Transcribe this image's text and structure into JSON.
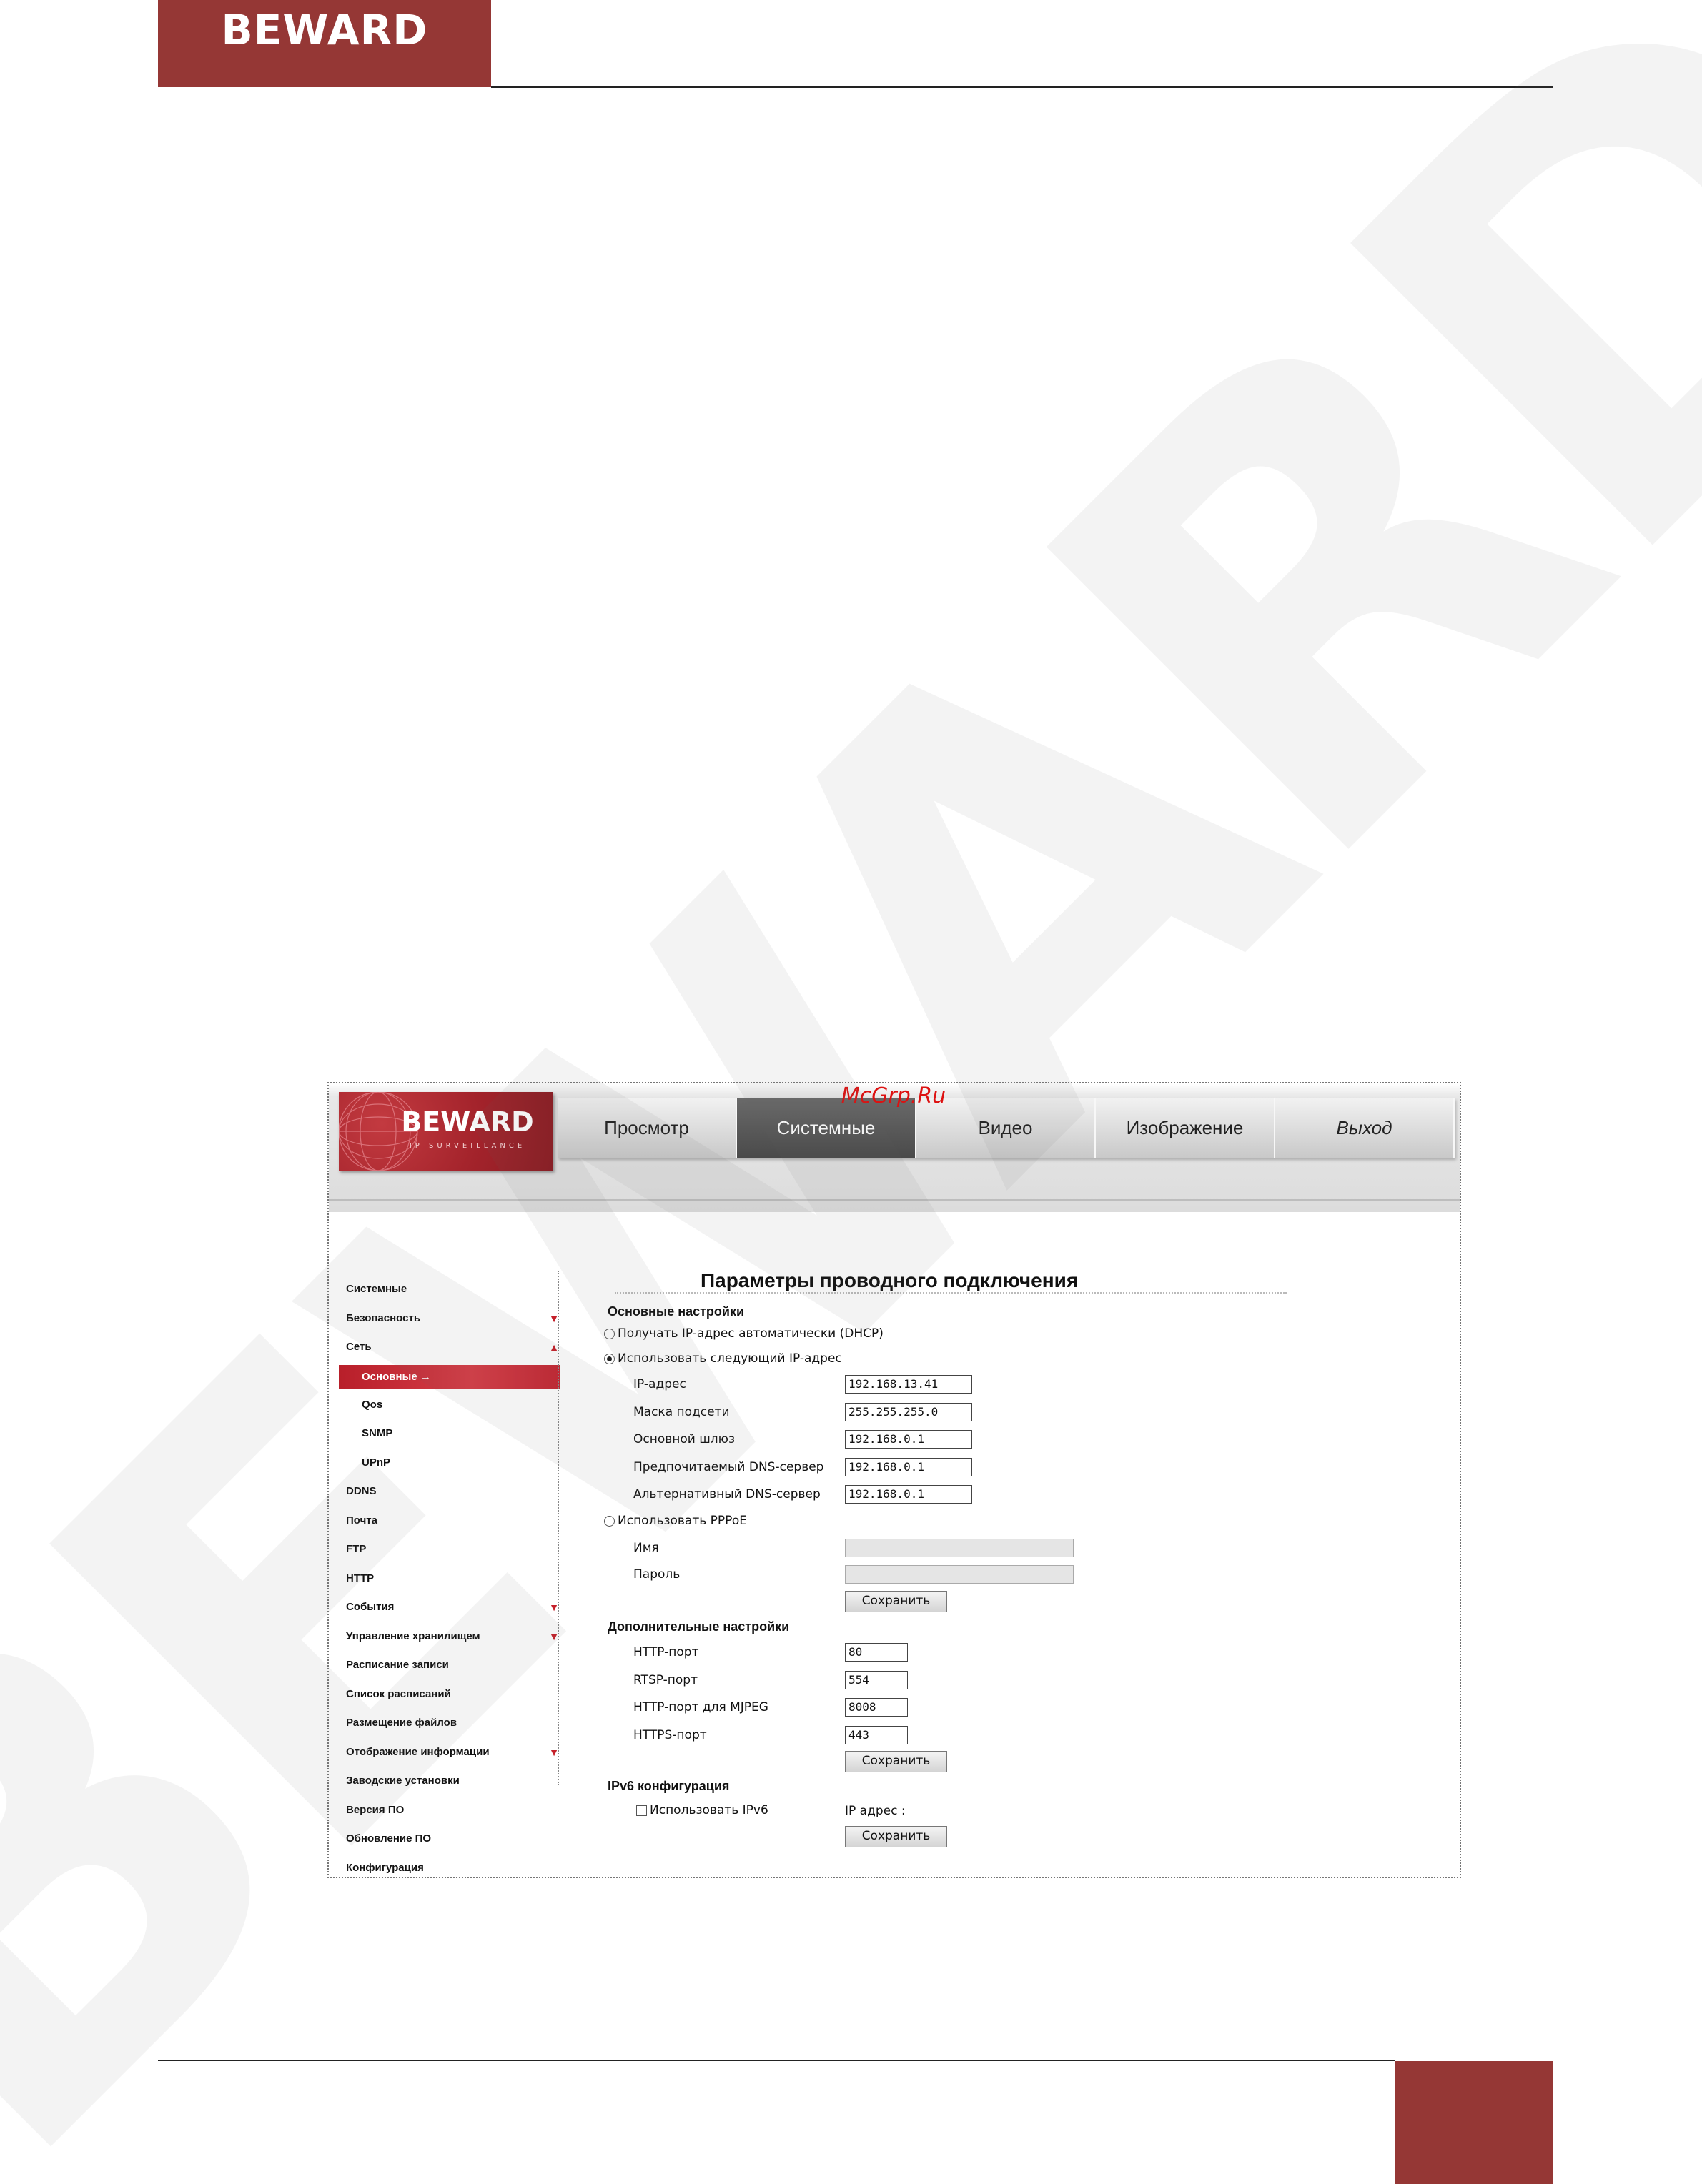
{
  "header": {
    "logo": "BEWARD"
  },
  "app": {
    "logo": "BEWARD",
    "logo_sub": "IP SURVEILLANCE",
    "overlay": "McGrp.Ru",
    "tabs": [
      "Просмотр",
      "Системные",
      "Видео",
      "Изображение",
      "Выход"
    ],
    "active_tab": "Системные"
  },
  "sidebar": {
    "items": [
      {
        "label": "Системные",
        "arrow": ""
      },
      {
        "label": "Безопасность",
        "arrow": "▼"
      },
      {
        "label": "Сеть",
        "arrow": "▲"
      },
      {
        "label": "Основные →",
        "arrow": "",
        "sub": true,
        "active": true
      },
      {
        "label": "Qos",
        "arrow": "",
        "sub": true
      },
      {
        "label": "SNMP",
        "arrow": "",
        "sub": true
      },
      {
        "label": "UPnP",
        "arrow": "",
        "sub": true
      },
      {
        "label": "DDNS",
        "arrow": ""
      },
      {
        "label": "Почта",
        "arrow": ""
      },
      {
        "label": "FTP",
        "arrow": ""
      },
      {
        "label": "HTTP",
        "arrow": ""
      },
      {
        "label": "События",
        "arrow": "▼"
      },
      {
        "label": "Управление хранилищем",
        "arrow": "▼"
      },
      {
        "label": "Расписание записи",
        "arrow": ""
      },
      {
        "label": "Список расписаний",
        "arrow": ""
      },
      {
        "label": "Размещение файлов",
        "arrow": ""
      },
      {
        "label": "Отображение информации",
        "arrow": "▼"
      },
      {
        "label": "Заводские установки",
        "arrow": ""
      },
      {
        "label": "Версия ПО",
        "arrow": ""
      },
      {
        "label": "Обновление ПО",
        "arrow": ""
      },
      {
        "label": "Конфигурация",
        "arrow": ""
      }
    ]
  },
  "main": {
    "title": "Параметры проводного подключения",
    "basic": {
      "heading": "Основные настройки",
      "dhcp_label": "Получать IP-адрес автоматически (DHCP)",
      "static_label": "Использовать следующий IP-адрес",
      "ip_label": "IP-адрес",
      "ip_value": "192.168.13.41",
      "mask_label": "Маска подсети",
      "mask_value": "255.255.255.0",
      "gateway_label": "Основной шлюз",
      "gateway_value": "192.168.0.1",
      "dns1_label": "Предпочитаемый DNS-сервер",
      "dns1_value": "192.168.0.1",
      "dns2_label": "Альтернативный DNS-сервер",
      "dns2_value": "192.168.0.1",
      "pppoe_label": "Использовать PPPoE",
      "name_label": "Имя",
      "password_label": "Пароль",
      "save": "Сохранить"
    },
    "advanced": {
      "heading": "Дополнительные настройки",
      "http_label": "HTTP-порт",
      "http_value": "80",
      "rtsp_label": "RTSP-порт",
      "rtsp_value": "554",
      "mjpeg_label": "HTTP-порт для MJPEG",
      "mjpeg_value": "8008",
      "https_label": "HTTPS-порт",
      "https_value": "443",
      "save": "Сохранить"
    },
    "ipv6": {
      "heading": "IPv6 конфигурация",
      "use_label": "Использовать IPv6",
      "ip_label": "IP адрес :",
      "save": "Сохранить"
    }
  },
  "colors": {
    "brand": "#953735",
    "accent": "#c5202a"
  }
}
